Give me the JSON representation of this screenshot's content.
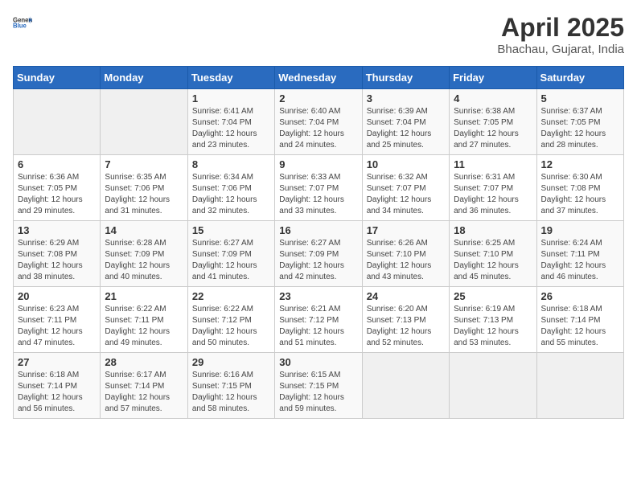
{
  "header": {
    "logo_general": "General",
    "logo_blue": "Blue",
    "main_title": "April 2025",
    "subtitle": "Bhachau, Gujarat, India"
  },
  "calendar": {
    "days_of_week": [
      "Sunday",
      "Monday",
      "Tuesday",
      "Wednesday",
      "Thursday",
      "Friday",
      "Saturday"
    ],
    "weeks": [
      [
        {
          "day": "",
          "sunrise": "",
          "sunset": "",
          "daylight": ""
        },
        {
          "day": "",
          "sunrise": "",
          "sunset": "",
          "daylight": ""
        },
        {
          "day": "1",
          "sunrise": "Sunrise: 6:41 AM",
          "sunset": "Sunset: 7:04 PM",
          "daylight": "Daylight: 12 hours and 23 minutes."
        },
        {
          "day": "2",
          "sunrise": "Sunrise: 6:40 AM",
          "sunset": "Sunset: 7:04 PM",
          "daylight": "Daylight: 12 hours and 24 minutes."
        },
        {
          "day": "3",
          "sunrise": "Sunrise: 6:39 AM",
          "sunset": "Sunset: 7:04 PM",
          "daylight": "Daylight: 12 hours and 25 minutes."
        },
        {
          "day": "4",
          "sunrise": "Sunrise: 6:38 AM",
          "sunset": "Sunset: 7:05 PM",
          "daylight": "Daylight: 12 hours and 27 minutes."
        },
        {
          "day": "5",
          "sunrise": "Sunrise: 6:37 AM",
          "sunset": "Sunset: 7:05 PM",
          "daylight": "Daylight: 12 hours and 28 minutes."
        }
      ],
      [
        {
          "day": "6",
          "sunrise": "Sunrise: 6:36 AM",
          "sunset": "Sunset: 7:05 PM",
          "daylight": "Daylight: 12 hours and 29 minutes."
        },
        {
          "day": "7",
          "sunrise": "Sunrise: 6:35 AM",
          "sunset": "Sunset: 7:06 PM",
          "daylight": "Daylight: 12 hours and 31 minutes."
        },
        {
          "day": "8",
          "sunrise": "Sunrise: 6:34 AM",
          "sunset": "Sunset: 7:06 PM",
          "daylight": "Daylight: 12 hours and 32 minutes."
        },
        {
          "day": "9",
          "sunrise": "Sunrise: 6:33 AM",
          "sunset": "Sunset: 7:07 PM",
          "daylight": "Daylight: 12 hours and 33 minutes."
        },
        {
          "day": "10",
          "sunrise": "Sunrise: 6:32 AM",
          "sunset": "Sunset: 7:07 PM",
          "daylight": "Daylight: 12 hours and 34 minutes."
        },
        {
          "day": "11",
          "sunrise": "Sunrise: 6:31 AM",
          "sunset": "Sunset: 7:07 PM",
          "daylight": "Daylight: 12 hours and 36 minutes."
        },
        {
          "day": "12",
          "sunrise": "Sunrise: 6:30 AM",
          "sunset": "Sunset: 7:08 PM",
          "daylight": "Daylight: 12 hours and 37 minutes."
        }
      ],
      [
        {
          "day": "13",
          "sunrise": "Sunrise: 6:29 AM",
          "sunset": "Sunset: 7:08 PM",
          "daylight": "Daylight: 12 hours and 38 minutes."
        },
        {
          "day": "14",
          "sunrise": "Sunrise: 6:28 AM",
          "sunset": "Sunset: 7:09 PM",
          "daylight": "Daylight: 12 hours and 40 minutes."
        },
        {
          "day": "15",
          "sunrise": "Sunrise: 6:27 AM",
          "sunset": "Sunset: 7:09 PM",
          "daylight": "Daylight: 12 hours and 41 minutes."
        },
        {
          "day": "16",
          "sunrise": "Sunrise: 6:27 AM",
          "sunset": "Sunset: 7:09 PM",
          "daylight": "Daylight: 12 hours and 42 minutes."
        },
        {
          "day": "17",
          "sunrise": "Sunrise: 6:26 AM",
          "sunset": "Sunset: 7:10 PM",
          "daylight": "Daylight: 12 hours and 43 minutes."
        },
        {
          "day": "18",
          "sunrise": "Sunrise: 6:25 AM",
          "sunset": "Sunset: 7:10 PM",
          "daylight": "Daylight: 12 hours and 45 minutes."
        },
        {
          "day": "19",
          "sunrise": "Sunrise: 6:24 AM",
          "sunset": "Sunset: 7:11 PM",
          "daylight": "Daylight: 12 hours and 46 minutes."
        }
      ],
      [
        {
          "day": "20",
          "sunrise": "Sunrise: 6:23 AM",
          "sunset": "Sunset: 7:11 PM",
          "daylight": "Daylight: 12 hours and 47 minutes."
        },
        {
          "day": "21",
          "sunrise": "Sunrise: 6:22 AM",
          "sunset": "Sunset: 7:11 PM",
          "daylight": "Daylight: 12 hours and 49 minutes."
        },
        {
          "day": "22",
          "sunrise": "Sunrise: 6:22 AM",
          "sunset": "Sunset: 7:12 PM",
          "daylight": "Daylight: 12 hours and 50 minutes."
        },
        {
          "day": "23",
          "sunrise": "Sunrise: 6:21 AM",
          "sunset": "Sunset: 7:12 PM",
          "daylight": "Daylight: 12 hours and 51 minutes."
        },
        {
          "day": "24",
          "sunrise": "Sunrise: 6:20 AM",
          "sunset": "Sunset: 7:13 PM",
          "daylight": "Daylight: 12 hours and 52 minutes."
        },
        {
          "day": "25",
          "sunrise": "Sunrise: 6:19 AM",
          "sunset": "Sunset: 7:13 PM",
          "daylight": "Daylight: 12 hours and 53 minutes."
        },
        {
          "day": "26",
          "sunrise": "Sunrise: 6:18 AM",
          "sunset": "Sunset: 7:14 PM",
          "daylight": "Daylight: 12 hours and 55 minutes."
        }
      ],
      [
        {
          "day": "27",
          "sunrise": "Sunrise: 6:18 AM",
          "sunset": "Sunset: 7:14 PM",
          "daylight": "Daylight: 12 hours and 56 minutes."
        },
        {
          "day": "28",
          "sunrise": "Sunrise: 6:17 AM",
          "sunset": "Sunset: 7:14 PM",
          "daylight": "Daylight: 12 hours and 57 minutes."
        },
        {
          "day": "29",
          "sunrise": "Sunrise: 6:16 AM",
          "sunset": "Sunset: 7:15 PM",
          "daylight": "Daylight: 12 hours and 58 minutes."
        },
        {
          "day": "30",
          "sunrise": "Sunrise: 6:15 AM",
          "sunset": "Sunset: 7:15 PM",
          "daylight": "Daylight: 12 hours and 59 minutes."
        },
        {
          "day": "",
          "sunrise": "",
          "sunset": "",
          "daylight": ""
        },
        {
          "day": "",
          "sunrise": "",
          "sunset": "",
          "daylight": ""
        },
        {
          "day": "",
          "sunrise": "",
          "sunset": "",
          "daylight": ""
        }
      ]
    ]
  }
}
